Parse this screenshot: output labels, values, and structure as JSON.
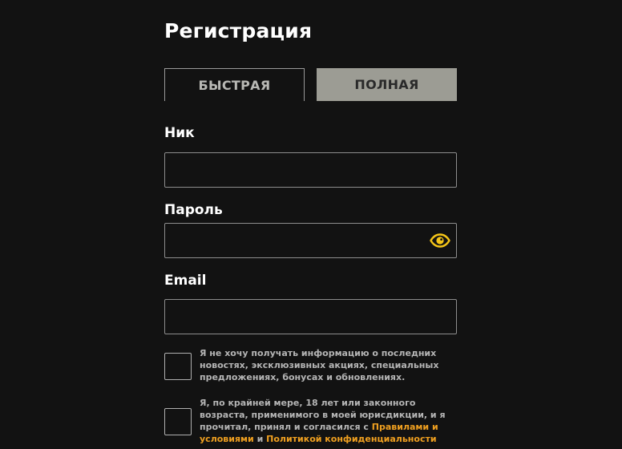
{
  "form": {
    "title": "Регистрация",
    "tabs": [
      {
        "label": "БЫСТРАЯ",
        "active": true
      },
      {
        "label": "ПОЛНАЯ",
        "active": false
      }
    ],
    "fields": {
      "nick": {
        "label": "Ник",
        "value": "",
        "placeholder": ""
      },
      "password": {
        "label": "Пароль",
        "value": "",
        "placeholder": "",
        "toggle_icon": "eye-icon"
      },
      "email": {
        "label": "Email",
        "value": "",
        "placeholder": ""
      }
    },
    "checkboxes": {
      "newsletter": {
        "checked": false,
        "text": "Я не хочу получать информацию о последних новостях, эксклюзивных акциях, специальных предложениях, бонусах и обновлениях."
      },
      "terms": {
        "checked": false,
        "text_before": "Я, по крайней мере, 18 лет или законного возраста, применимого в моей юрисдикции, и я прочитал, принял и согласился с ",
        "link_terms": "Правилами и условиями",
        "text_middle": " и ",
        "link_privacy": "Политикой конфиденциальности"
      }
    }
  },
  "colors": {
    "background": "#121212",
    "accent_link": "#f0a020",
    "eye_icon": "#f5c518",
    "inactive_tab": "#9c9c94"
  }
}
